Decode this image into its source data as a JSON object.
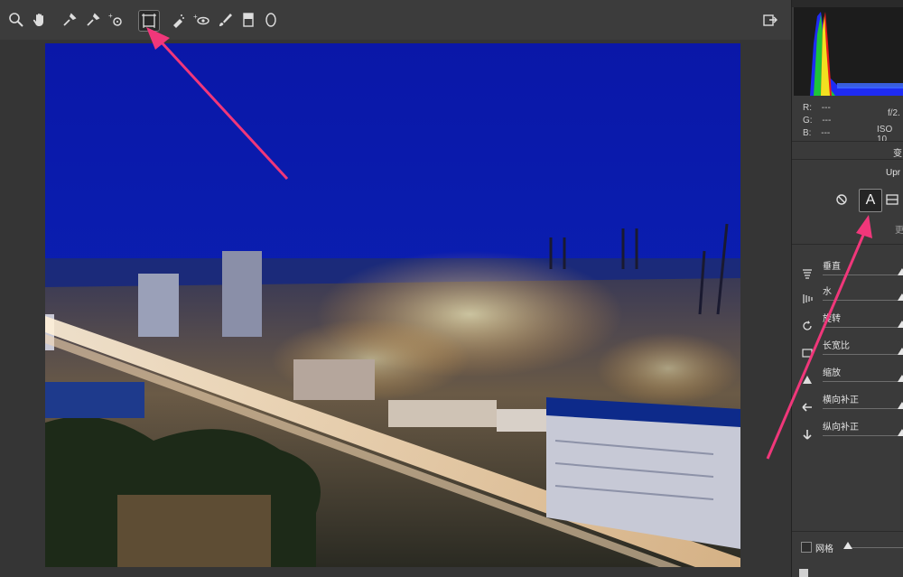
{
  "toolbar": {
    "tools": [
      {
        "id": "zoom",
        "icon": "zoom-icon"
      },
      {
        "id": "hand",
        "icon": "hand-icon"
      },
      {
        "id": "white-balance",
        "icon": "eyedropper-icon"
      },
      {
        "id": "color-sampler",
        "icon": "color-sampler-icon"
      },
      {
        "id": "targeted-adjustment",
        "icon": "target-adjust-icon"
      },
      {
        "id": "transform",
        "icon": "transform-icon",
        "active": true
      },
      {
        "id": "spot-removal",
        "icon": "spot-removal-icon"
      },
      {
        "id": "red-eye",
        "icon": "red-eye-icon"
      },
      {
        "id": "brush",
        "icon": "brush-icon"
      },
      {
        "id": "graduated-filter",
        "icon": "graduated-filter-icon"
      },
      {
        "id": "radial-filter",
        "icon": "radial-filter-icon"
      }
    ],
    "export_icon": "export-icon"
  },
  "histogram": {
    "r_label": "R:",
    "r_value": "---",
    "g_label": "G:",
    "g_value": "---",
    "b_label": "B:",
    "b_value": "---",
    "aperture": "f/2.",
    "iso": "ISO 10"
  },
  "panel": {
    "section_title": "变",
    "upright_label": "Upr",
    "more_label": "更",
    "sliders": [
      {
        "label": "垂直",
        "icon": "vertical-icon"
      },
      {
        "label": "水",
        "icon": "horizontal-icon"
      },
      {
        "label": "旋转",
        "icon": "rotate-icon"
      },
      {
        "label": "长宽比",
        "icon": "aspect-icon"
      },
      {
        "label": "缩放",
        "icon": "scale-icon"
      },
      {
        "label": "横向补正",
        "icon": "x-offset-icon"
      },
      {
        "label": "纵向补正",
        "icon": "y-offset-icon"
      }
    ],
    "grid_label": "网格",
    "upright_auto_glyph": "A"
  },
  "colors": {
    "toolbar_bg": "#3c3c3c",
    "panel_bg": "#3a3a3a",
    "annotation_arrow": "#f0377a",
    "sky": "#0a1cb0"
  }
}
